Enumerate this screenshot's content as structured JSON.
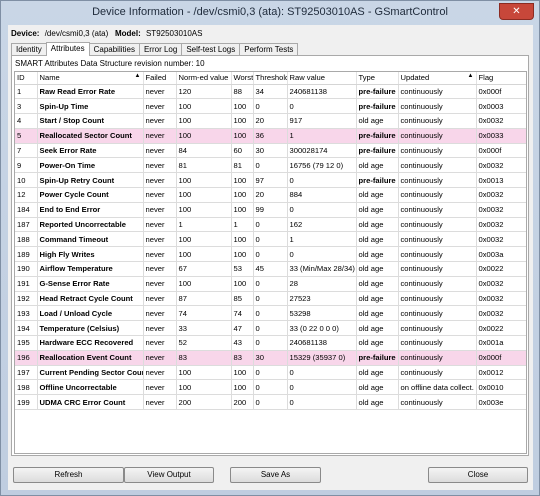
{
  "window": {
    "title": "Device Information - /dev/csmi0,3 (ata): ST92503010AS - GSmartControl",
    "close_glyph": "✕"
  },
  "device": {
    "device_label": "Device:",
    "device_value": "/dev/csmi0,3 (ata)",
    "model_label": "Model:",
    "model_value": "ST92503010AS"
  },
  "tabs": [
    {
      "label": "Identity",
      "active": false
    },
    {
      "label": "Attributes",
      "active": true
    },
    {
      "label": "Capabilities",
      "active": false
    },
    {
      "label": "Error Log",
      "active": false
    },
    {
      "label": "Self-test Logs",
      "active": false
    },
    {
      "label": "Perform Tests",
      "active": false
    }
  ],
  "revision_text": "SMART Attributes Data Structure revision number: 10",
  "columns": [
    "ID",
    "Name",
    "Failed",
    "Norm-ed value",
    "Worst",
    "Threshold",
    "Raw value",
    "Type",
    "Updated",
    "Flag"
  ],
  "sort_glyph": "▲",
  "rows": [
    {
      "id": "1",
      "name": "Raw Read Error Rate",
      "failed": "never",
      "norm": "120",
      "worst": "88",
      "thresh": "34",
      "raw": "240681138",
      "type": "pre-failure",
      "updated": "continuously",
      "flag": "0x000f",
      "highlight": false
    },
    {
      "id": "3",
      "name": "Spin-Up Time",
      "failed": "never",
      "norm": "100",
      "worst": "100",
      "thresh": "0",
      "raw": "0",
      "type": "pre-failure",
      "updated": "continuously",
      "flag": "0x0003",
      "highlight": false
    },
    {
      "id": "4",
      "name": "Start / Stop Count",
      "failed": "never",
      "norm": "100",
      "worst": "100",
      "thresh": "20",
      "raw": "917",
      "type": "old age",
      "updated": "continuously",
      "flag": "0x0032",
      "highlight": false
    },
    {
      "id": "5",
      "name": "Reallocated Sector Count",
      "failed": "never",
      "norm": "100",
      "worst": "100",
      "thresh": "36",
      "raw": "1",
      "type": "pre-failure",
      "updated": "continuously",
      "flag": "0x0033",
      "highlight": true
    },
    {
      "id": "7",
      "name": "Seek Error Rate",
      "failed": "never",
      "norm": "84",
      "worst": "60",
      "thresh": "30",
      "raw": "300028174",
      "type": "pre-failure",
      "updated": "continuously",
      "flag": "0x000f",
      "highlight": false
    },
    {
      "id": "9",
      "name": "Power-On Time",
      "failed": "never",
      "norm": "81",
      "worst": "81",
      "thresh": "0",
      "raw": "16756 (79 12 0)",
      "type": "old age",
      "updated": "continuously",
      "flag": "0x0032",
      "highlight": false
    },
    {
      "id": "10",
      "name": "Spin-Up Retry Count",
      "failed": "never",
      "norm": "100",
      "worst": "100",
      "thresh": "97",
      "raw": "0",
      "type": "pre-failure",
      "updated": "continuously",
      "flag": "0x0013",
      "highlight": false
    },
    {
      "id": "12",
      "name": "Power Cycle Count",
      "failed": "never",
      "norm": "100",
      "worst": "100",
      "thresh": "20",
      "raw": "884",
      "type": "old age",
      "updated": "continuously",
      "flag": "0x0032",
      "highlight": false
    },
    {
      "id": "184",
      "name": "End to End Error",
      "failed": "never",
      "norm": "100",
      "worst": "100",
      "thresh": "99",
      "raw": "0",
      "type": "old age",
      "updated": "continuously",
      "flag": "0x0032",
      "highlight": false
    },
    {
      "id": "187",
      "name": "Reported Uncorrectable",
      "failed": "never",
      "norm": "1",
      "worst": "1",
      "thresh": "0",
      "raw": "162",
      "type": "old age",
      "updated": "continuously",
      "flag": "0x0032",
      "highlight": false
    },
    {
      "id": "188",
      "name": "Command Timeout",
      "failed": "never",
      "norm": "100",
      "worst": "100",
      "thresh": "0",
      "raw": "1",
      "type": "old age",
      "updated": "continuously",
      "flag": "0x0032",
      "highlight": false
    },
    {
      "id": "189",
      "name": "High Fly Writes",
      "failed": "never",
      "norm": "100",
      "worst": "100",
      "thresh": "0",
      "raw": "0",
      "type": "old age",
      "updated": "continuously",
      "flag": "0x003a",
      "highlight": false
    },
    {
      "id": "190",
      "name": "Airflow Temperature",
      "failed": "never",
      "norm": "67",
      "worst": "53",
      "thresh": "45",
      "raw": "33 (Min/Max 28/34)",
      "type": "old age",
      "updated": "continuously",
      "flag": "0x0022",
      "highlight": false
    },
    {
      "id": "191",
      "name": "G-Sense Error Rate",
      "failed": "never",
      "norm": "100",
      "worst": "100",
      "thresh": "0",
      "raw": "28",
      "type": "old age",
      "updated": "continuously",
      "flag": "0x0032",
      "highlight": false
    },
    {
      "id": "192",
      "name": "Head Retract Cycle Count",
      "failed": "never",
      "norm": "87",
      "worst": "85",
      "thresh": "0",
      "raw": "27523",
      "type": "old age",
      "updated": "continuously",
      "flag": "0x0032",
      "highlight": false
    },
    {
      "id": "193",
      "name": "Load / Unload Cycle",
      "failed": "never",
      "norm": "74",
      "worst": "74",
      "thresh": "0",
      "raw": "53298",
      "type": "old age",
      "updated": "continuously",
      "flag": "0x0032",
      "highlight": false
    },
    {
      "id": "194",
      "name": "Temperature (Celsius)",
      "failed": "never",
      "norm": "33",
      "worst": "47",
      "thresh": "0",
      "raw": "33 (0 22 0 0 0)",
      "type": "old age",
      "updated": "continuously",
      "flag": "0x0022",
      "highlight": false
    },
    {
      "id": "195",
      "name": "Hardware ECC Recovered",
      "failed": "never",
      "norm": "52",
      "worst": "43",
      "thresh": "0",
      "raw": "240681138",
      "type": "old age",
      "updated": "continuously",
      "flag": "0x001a",
      "highlight": false
    },
    {
      "id": "196",
      "name": "Reallocation Event Count",
      "failed": "never",
      "norm": "83",
      "worst": "83",
      "thresh": "30",
      "raw": "15329 (35937 0)",
      "type": "pre-failure",
      "updated": "continuously",
      "flag": "0x000f",
      "highlight": true
    },
    {
      "id": "197",
      "name": "Current Pending Sector Count",
      "failed": "never",
      "norm": "100",
      "worst": "100",
      "thresh": "0",
      "raw": "0",
      "type": "old age",
      "updated": "continuously",
      "flag": "0x0012",
      "highlight": false
    },
    {
      "id": "198",
      "name": "Offline Uncorrectable",
      "failed": "never",
      "norm": "100",
      "worst": "100",
      "thresh": "0",
      "raw": "0",
      "type": "old age",
      "updated": "on offline data collect.",
      "flag": "0x0010",
      "highlight": false
    },
    {
      "id": "199",
      "name": "UDMA CRC Error Count",
      "failed": "never",
      "norm": "200",
      "worst": "200",
      "thresh": "0",
      "raw": "0",
      "type": "old age",
      "updated": "continuously",
      "flag": "0x003e",
      "highlight": false
    }
  ],
  "buttons": {
    "refresh": "Refresh",
    "view_output": "View Output",
    "save_as": "Save As",
    "close": "Close"
  }
}
